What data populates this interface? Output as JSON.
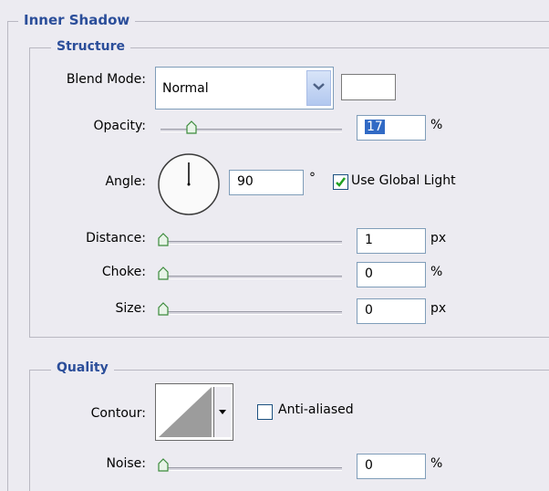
{
  "section_title": "Inner Shadow",
  "structure": {
    "title": "Structure",
    "blend_mode": {
      "label": "Blend Mode:",
      "value": "Normal",
      "color": "#ffffff"
    },
    "opacity": {
      "label": "Opacity:",
      "value": "17",
      "unit": "%",
      "level": 0.17
    },
    "angle": {
      "label": "Angle:",
      "value": "90",
      "unit": "°",
      "use_global_light_label": "Use Global Light",
      "use_global_light_checked": true
    },
    "distance": {
      "label": "Distance:",
      "value": "1",
      "unit": "px",
      "level": 0.0
    },
    "choke": {
      "label": "Choke:",
      "value": "0",
      "unit": "%",
      "level": 0.0
    },
    "size": {
      "label": "Size:",
      "value": "0",
      "unit": "px",
      "level": 0.0
    }
  },
  "quality": {
    "title": "Quality",
    "contour": {
      "label": "Contour:",
      "anti_aliased_label": "Anti-aliased",
      "anti_aliased_checked": false
    },
    "noise": {
      "label": "Noise:",
      "value": "0",
      "unit": "%",
      "level": 0.0
    }
  }
}
